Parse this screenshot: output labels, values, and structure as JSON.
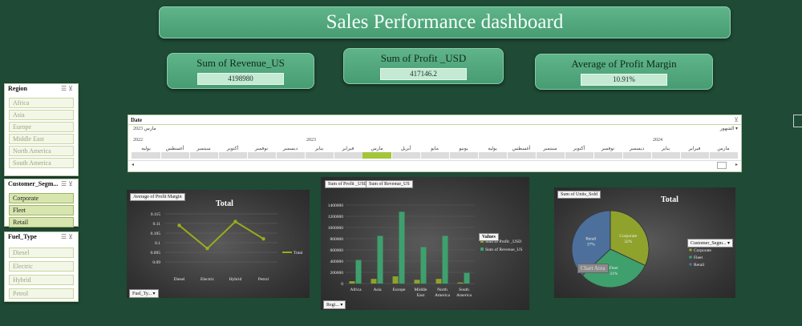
{
  "dashboard": {
    "title": "Sales Performance dashboard"
  },
  "kpis": [
    {
      "label": "Sum of Revenue_US",
      "value": "4198980"
    },
    {
      "label": "Sum of Profit _USD",
      "value": "417146.2"
    },
    {
      "label": "Average of Profit Margin",
      "value": "10.91%"
    }
  ],
  "slicers": {
    "region": {
      "title": "Region",
      "items": [
        "Africa",
        "Asia",
        "Europe",
        "Middle East",
        "North America",
        "South America"
      ]
    },
    "segment": {
      "title": "Customer_Segm...",
      "items": [
        "Corporate",
        "Fleet",
        "Retail"
      ]
    },
    "fuel": {
      "title": "Fuel_Type",
      "items": [
        "Diesel",
        "Electric",
        "Hybrid",
        "Petrol"
      ]
    }
  },
  "timeline": {
    "title": "Date",
    "selection": "مارس 2023",
    "level": "الشهور",
    "years": [
      "2022",
      "2023",
      "2024"
    ],
    "months": [
      "يوليه",
      "أغسطس",
      "سبتمبر",
      "أكتوبر",
      "نوفمبر",
      "ديسمبر",
      "يناير",
      "فبراير",
      "مارس",
      "أبريل",
      "مايو",
      "يونيو",
      "يوليه",
      "أغسطس",
      "سبتمبر",
      "أكتوبر",
      "نوفمبر",
      "ديسمبر",
      "يناير",
      "فبراير",
      "مارس"
    ],
    "selected_index": 8,
    "colors": {
      "selected": "#a3c63c",
      "track": "#dcdcdc"
    }
  },
  "charts": {
    "line": {
      "field_tag": "Average of Profit Margin",
      "title": "Total",
      "legend": "Total",
      "filter_tag": "Fuel_Ty...",
      "color": "#9cab1e"
    },
    "bar": {
      "field_tags": [
        "Sum of Profit _USD",
        "Sum of Revenue_US"
      ],
      "legend_title": "Values",
      "filter_tag": "Regi...",
      "colors": {
        "profit": "#8fa32c",
        "revenue": "#3ea06d"
      }
    },
    "pie": {
      "field_tag": "Sum of Units_Sold",
      "title": "Total",
      "legend_title": "Customer_Segm...",
      "chart_area_label": "Chart Area",
      "colors": {
        "Corporate": "#8fa32c",
        "Fleet": "#3ea06d",
        "Retail": "#4c6f9c"
      }
    }
  },
  "chart_data": [
    {
      "type": "line",
      "title": "Total",
      "categories": [
        "Diesel",
        "Electric",
        "Hybrid",
        "Petrol"
      ],
      "series": [
        {
          "name": "Total",
          "values": [
            0.109,
            0.097,
            0.111,
            0.102
          ]
        }
      ],
      "ylim": [
        0.09,
        0.115
      ],
      "yticks": [
        "0.09",
        "0.095",
        "0.1",
        "0.105",
        "0.11",
        "0.115"
      ],
      "legend": "right"
    },
    {
      "type": "bar",
      "categories": [
        "Africa",
        "Asia",
        "Europe",
        "Middle East",
        "North America",
        "South America"
      ],
      "series": [
        {
          "name": "Sum of Profit _USD",
          "values": [
            41000,
            83000,
            128000,
            67000,
            83000,
            19000
          ]
        },
        {
          "name": "Sum of Revenue_US",
          "values": [
            420000,
            850000,
            1280000,
            650000,
            850000,
            190000
          ]
        }
      ],
      "ylim": [
        0,
        1400000
      ],
      "yticks": [
        "0",
        "200000",
        "400000",
        "600000",
        "800000",
        "1000000",
        "1200000",
        "1400000"
      ],
      "legend": "right"
    },
    {
      "type": "pie",
      "title": "Total",
      "labels": [
        "Corporate",
        "Fleet",
        "Retail"
      ],
      "values": [
        32,
        31,
        37
      ],
      "value_labels": [
        "32%",
        "31%",
        "37%"
      ],
      "legend": "right"
    }
  ]
}
